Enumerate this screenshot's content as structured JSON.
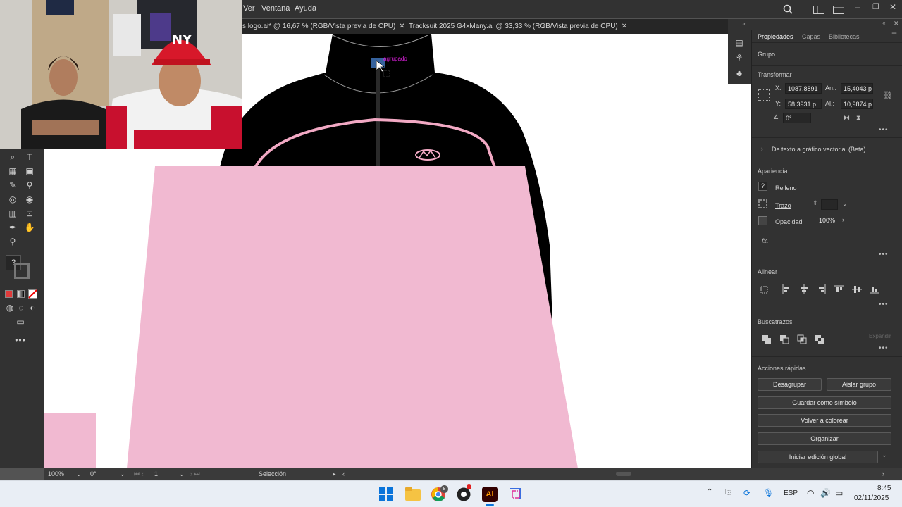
{
  "menubar": {
    "items": [
      "Ver",
      "Ventana",
      "Ayuda"
    ]
  },
  "tabs": [
    {
      "label": "s logo.ai* @ 16,67 % (RGB/Vista previa de CPU)"
    },
    {
      "label": "Tracksuit 2025 G4xMany.ai @ 33,33 % (RGB/Vista previa de CPU)"
    }
  ],
  "canvas": {
    "selection_label": "agrupado"
  },
  "panel": {
    "tabs": [
      "Propiedades",
      "Capas",
      "Bibliotecas"
    ],
    "group_label": "Grupo",
    "transform": {
      "heading": "Transformar",
      "x_label": "X:",
      "x_value": "1087,8891",
      "y_label": "Y:",
      "y_value": "58,3931 p",
      "w_label": "An.:",
      "w_value": "15,4043 p",
      "h_label": "Al.:",
      "h_value": "10,9874 p",
      "angle_value": "0°"
    },
    "text_to_vector": "De texto a gráfico vectorial (Beta)",
    "appearance": {
      "heading": "Apariencia",
      "fill_label": "Relleno",
      "fill_value": "?",
      "stroke_label": "Trazo",
      "opacity_label": "Opacidad",
      "opacity_value": "100%",
      "fx": "fx."
    },
    "align_heading": "Alinear",
    "pathfinder_heading": "Buscatrazos",
    "pathfinder_expand": "Expandir",
    "quick_actions": {
      "heading": "Acciones rápidas",
      "ungroup": "Desagrupar",
      "isolate": "Aislar grupo",
      "save_symbol": "Guardar como símbolo",
      "recolor": "Volver a colorear",
      "arrange": "Organizar",
      "global_edit": "Iniciar edición global"
    }
  },
  "status": {
    "zoom": "100%",
    "rotation": "0°",
    "artboard": "1",
    "tool": "Selección"
  },
  "taskbar": {
    "chrome_badge": "8",
    "language": "ESP",
    "time": "8:45",
    "date": "02/11/2025"
  },
  "colors": {
    "pink": "#f0b8d0",
    "jacket": "#000000",
    "trim": "#f2a9c4",
    "ui_dark": "#323232"
  }
}
